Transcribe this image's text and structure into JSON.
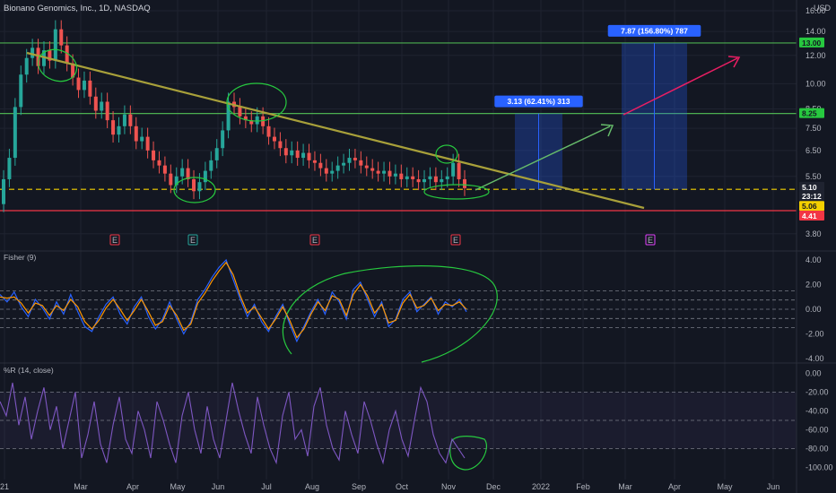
{
  "header": {
    "title": "Bionano Genomics, Inc., 1D, NASDAQ",
    "currency": "USD"
  },
  "colors": {
    "background": "#131722",
    "grid": "#1f2330",
    "axis_text": "#b2b5be",
    "candle_up": "#26a69a",
    "candle_down": "#ef5350",
    "fisher": "#2962ff",
    "fisher_trigger": "#ff9800",
    "williams": "#7e57c2",
    "green_level": "#4caf50",
    "red_level": "#f23645",
    "yellow_level": "#f5d000",
    "trendline": "#a8a03a",
    "annotation": "#27c93f",
    "arrow_up": "#66bb6a",
    "arrow_pink": "#e91e63",
    "target_box": "#1e4d7a"
  },
  "chart_data": [
    {
      "type": "candlestick",
      "title": "Bionano Genomics, Inc., 1D, NASDAQ",
      "scale": "log",
      "ylabel": "USD",
      "y_ticks": [
        3.8,
        4.41,
        5.06,
        5.1,
        5.5,
        6.5,
        7.5,
        8.5,
        10.0,
        12.0,
        14.0,
        16.0
      ],
      "x_ticks": [
        "21",
        "Mar",
        "Apr",
        "May",
        "Jun",
        "Jul",
        "Aug",
        "Sep",
        "Oct",
        "Nov",
        "Dec",
        "2022",
        "Feb",
        "Mar",
        "Apr",
        "May",
        "Jun"
      ],
      "horizontal_levels": [
        {
          "label": "13.00",
          "value": 13.0,
          "kind": "resistance"
        },
        {
          "label": "8.25",
          "value": 8.25,
          "kind": "resistance"
        },
        {
          "label": "5.10",
          "value": 5.1,
          "kind": "current price"
        },
        {
          "label": "23:12",
          "value": 5.1,
          "kind": "countdown"
        },
        {
          "label": "5.06",
          "value": 5.06,
          "kind": "support"
        },
        {
          "label": "4.41",
          "value": 4.41,
          "kind": "support"
        }
      ],
      "targets": [
        {
          "label": "3.13 (62.41%) 313",
          "from": 5.06,
          "to": 8.25
        },
        {
          "label": "7.87 (156.80%) 787",
          "from": 5.06,
          "to": 13.0
        }
      ],
      "earnings_markers": [
        "E",
        "E",
        "E",
        "E",
        "E"
      ],
      "approx_closes": [
        5.4,
        6.2,
        8.6,
        10.6,
        11.8,
        12.6,
        11.2,
        12.4,
        11.6,
        14.2,
        12.8,
        11.4,
        10.4,
        9.6,
        10.2,
        9.2,
        8.4,
        8.9,
        7.9,
        7.2,
        7.6,
        8.2,
        7.6,
        6.9,
        7.1,
        6.5,
        6.1,
        5.9,
        5.6,
        5.2,
        5.5,
        5.8,
        5.4,
        5.0,
        5.3,
        5.7,
        6.1,
        6.6,
        7.4,
        8.9,
        8.6,
        8.1,
        7.9,
        7.7,
        8.1,
        7.6,
        7.1,
        6.9,
        6.6,
        6.3,
        6.5,
        6.2,
        6.4,
        6.1,
        6.0,
        5.8,
        5.6,
        5.7,
        5.9,
        6.0,
        6.2,
        6.1,
        5.9,
        5.8,
        5.7,
        5.6,
        5.7,
        5.5,
        5.6,
        5.4,
        5.5,
        5.4,
        5.3,
        5.4,
        5.5,
        5.3,
        5.4,
        5.5,
        6.0,
        5.4,
        5.1
      ]
    },
    {
      "type": "line",
      "title": "Fisher (9)",
      "y_ticks": [
        4.0,
        2.0,
        0.0,
        -2.0,
        -4.0
      ],
      "levels": [
        1.5,
        0.75,
        0,
        -0.75,
        -1.5
      ],
      "series": [
        {
          "values": [
            1.2,
            0.6,
            1.4,
            0.2,
            -0.6,
            0.8,
            0.1,
            -0.8,
            0.6,
            -0.4,
            1.2,
            -0.2,
            -1.4,
            -1.8,
            -0.6,
            0.4,
            1.0,
            -0.4,
            -1.2,
            0.2,
            1.0,
            -0.6,
            -1.6,
            -0.8,
            0.6,
            -0.8,
            -2.0,
            -1.0,
            0.8,
            1.6,
            2.6,
            3.4,
            4.0,
            2.4,
            0.8,
            -0.6,
            0.4,
            -1.0,
            -1.8,
            -0.6,
            0.4,
            -1.2,
            -2.6,
            -1.4,
            -0.2,
            0.8,
            -0.4,
            1.4,
            0.6,
            -0.8,
            1.6,
            2.2,
            0.8,
            -0.6,
            0.6,
            -1.4,
            -0.8,
            0.8,
            1.4,
            -0.2,
            0.4,
            1.0,
            -0.4,
            0.6,
            0.2,
            0.8,
            -0.2
          ]
        },
        {
          "values": [
            1.0,
            0.9,
            1.0,
            0.5,
            -0.3,
            0.5,
            0.3,
            -0.5,
            0.3,
            -0.1,
            0.8,
            0.2,
            -1.0,
            -1.6,
            -0.9,
            0.1,
            0.8,
            0.0,
            -0.9,
            -0.1,
            0.8,
            -0.2,
            -1.3,
            -1.0,
            0.3,
            -0.5,
            -1.7,
            -1.2,
            0.5,
            1.3,
            2.3,
            3.1,
            3.8,
            2.8,
            1.1,
            -0.3,
            0.2,
            -0.7,
            -1.6,
            -0.8,
            0.2,
            -0.9,
            -2.3,
            -1.6,
            -0.4,
            0.6,
            -0.1,
            1.1,
            0.8,
            -0.5,
            1.2,
            2.0,
            1.1,
            -0.3,
            0.4,
            -1.1,
            -0.9,
            0.5,
            1.2,
            0.1,
            0.3,
            0.9,
            -0.1,
            0.4,
            0.3,
            0.6,
            0.0
          ]
        }
      ]
    },
    {
      "type": "line",
      "title": "%R (14, close)",
      "y_ticks": [
        0.0,
        -20.0,
        -40.0,
        -60.0,
        -80.0,
        -100.0
      ],
      "levels": [
        -20,
        -50,
        -80
      ],
      "series": [
        {
          "values": [
            -30,
            -45,
            -10,
            -55,
            -25,
            -70,
            -40,
            -15,
            -60,
            -35,
            -80,
            -50,
            -20,
            -90,
            -65,
            -30,
            -75,
            -95,
            -55,
            -25,
            -70,
            -85,
            -40,
            -60,
            -90,
            -30,
            -50,
            -75,
            -95,
            -45,
            -20,
            -60,
            -85,
            -35,
            -70,
            -90,
            -50,
            -10,
            -40,
            -65,
            -85,
            -25,
            -55,
            -80,
            -95,
            -45,
            -20,
            -70,
            -60,
            -88,
            -35,
            -15,
            -55,
            -80,
            -92,
            -40,
            -65,
            -85,
            -30,
            -50,
            -75,
            -95,
            -60,
            -40,
            -70,
            -88,
            -50,
            -15,
            -30,
            -65,
            -85,
            -95,
            -70,
            -80,
            -90
          ]
        }
      ]
    }
  ]
}
